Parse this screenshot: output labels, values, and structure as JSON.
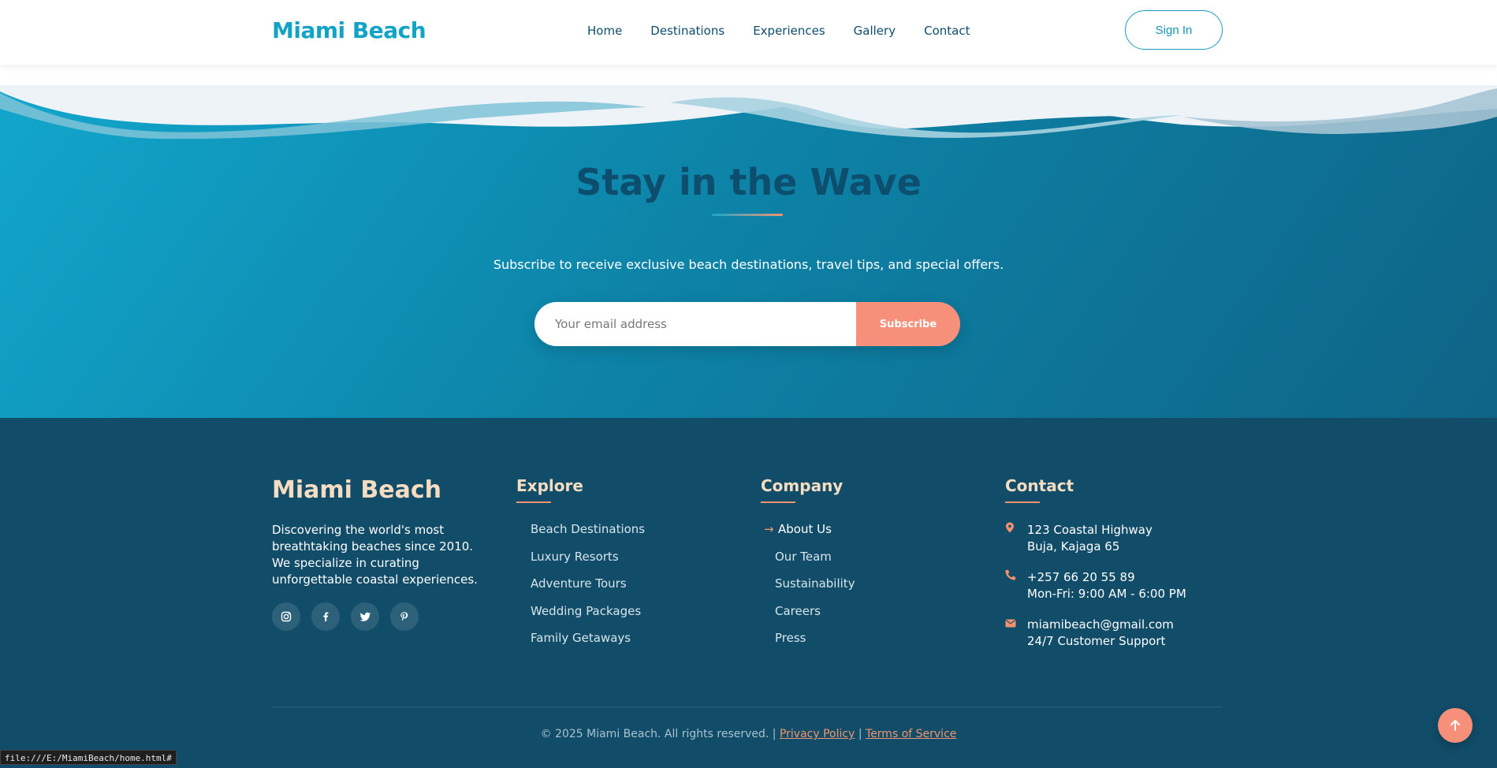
{
  "header": {
    "logo": "Miami Beach",
    "nav": [
      "Home",
      "Destinations",
      "Experiences",
      "Gallery",
      "Contact"
    ],
    "signin_label": "Sign In"
  },
  "newsletter": {
    "title": "Stay in the Wave",
    "subtitle": "Subscribe to receive exclusive beach destinations, travel tips, and special offers.",
    "email_placeholder": "Your email address",
    "subscribe_label": "Subscribe"
  },
  "footer": {
    "brand": "Miami Beach",
    "description": "Discovering the world's most breathtaking beaches since 2010. We specialize in curating unforgettable coastal experiences.",
    "socials": [
      "instagram-icon",
      "facebook-icon",
      "twitter-icon",
      "pinterest-icon"
    ],
    "explore": {
      "title": "Explore",
      "links": [
        "Beach Destinations",
        "Luxury Resorts",
        "Adventure Tours",
        "Wedding Packages",
        "Family Getaways"
      ]
    },
    "company": {
      "title": "Company",
      "active_arrow": "→",
      "links": [
        "About Us",
        "Our Team",
        "Sustainability",
        "Careers",
        "Press"
      ]
    },
    "contact": {
      "title": "Contact",
      "address_line1": "123 Coastal Highway",
      "address_line2": "Buja, Kajaga 65",
      "phone": "+257 66 20 55 89",
      "hours": "Mon-Fri: 9:00 AM - 6:00 PM",
      "email": "miamibeach@gmail.com",
      "support": "24/7 Customer Support"
    },
    "copyright": "© 2025 Miami Beach. All rights reserved. |",
    "privacy": "Privacy Policy",
    "separator": "|",
    "terms": "Terms of Service"
  },
  "status_url": "file:///E:/MiamiBeach/home.html#",
  "colors": {
    "accent": "#12a3c6",
    "coral": "#f7907a",
    "footer_bg": "#114c68",
    "brand_cream": "#f6dcc0"
  }
}
